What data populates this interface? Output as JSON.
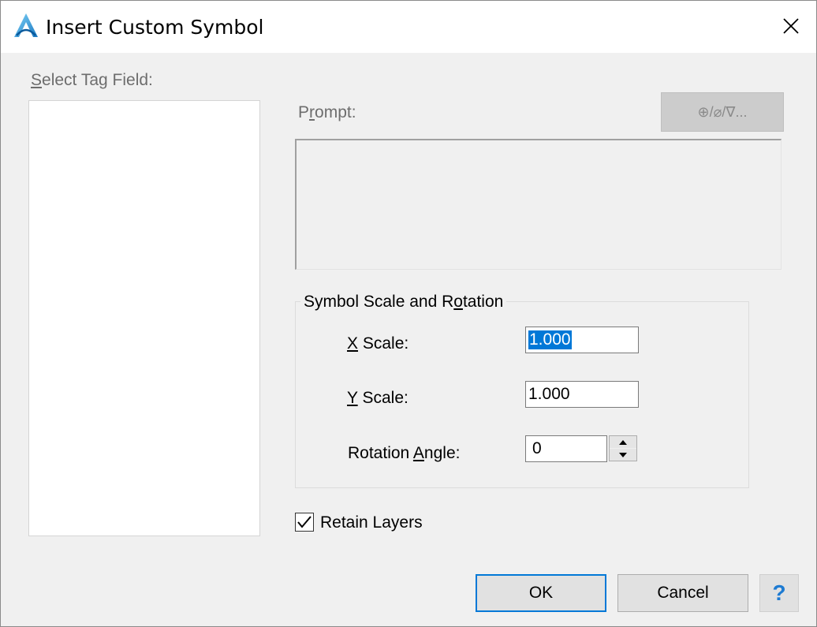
{
  "window": {
    "title": "Insert Custom Symbol",
    "app_icon": "autocad-a-icon",
    "close_icon": "close-x-icon"
  },
  "left": {
    "label_u": "S",
    "label_rest": "elect Tag Field:",
    "items": []
  },
  "prompt": {
    "label_pre": "P",
    "label_u": "r",
    "label_post": "ompt:",
    "symbol_button": "⊕/⌀/∇..."
  },
  "scale_rotation": {
    "title_pre": "Symbol Scale and R",
    "title_u": "o",
    "title_post": "tation",
    "x_label_u": "X",
    "x_label_rest": " Scale:",
    "x_value": "1.000",
    "y_label_u": "Y",
    "y_label_rest": " Scale:",
    "y_value": "1.000",
    "rot_label_pre": "Rotation ",
    "rot_label_u": "A",
    "rot_label_post": "ngle:",
    "rot_value": "0"
  },
  "retain_layers": {
    "label": "Retain Layers",
    "checked": true
  },
  "buttons": {
    "ok": "OK",
    "cancel": "Cancel",
    "help": "?"
  },
  "colors": {
    "accent": "#0078d7",
    "help": "#1e7bd2"
  }
}
